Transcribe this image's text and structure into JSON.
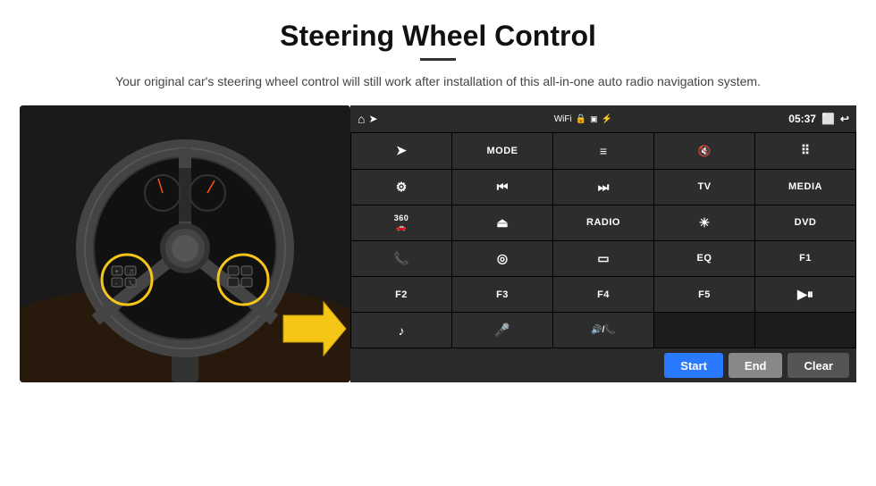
{
  "header": {
    "title": "Steering Wheel Control",
    "subtitle": "Your original car's steering wheel control will still work after installation of this all-in-one auto radio navigation system."
  },
  "status_bar": {
    "time": "05:37",
    "home_icon": "⌂",
    "wifi_icon": "WiFi",
    "lock_icon": "🔒",
    "sd_icon": "SD",
    "bt_icon": "BT",
    "screen_icon": "⬜",
    "back_icon": "↩"
  },
  "buttons": [
    {
      "id": "r1c1",
      "type": "icon",
      "label": "▷",
      "icon": "navigation"
    },
    {
      "id": "r1c2",
      "type": "text",
      "label": "MODE"
    },
    {
      "id": "r1c3",
      "type": "icon",
      "label": "≡",
      "icon": "list"
    },
    {
      "id": "r1c4",
      "type": "icon",
      "label": "🔇",
      "icon": "mute"
    },
    {
      "id": "r1c5",
      "type": "icon",
      "label": "⠿",
      "icon": "apps"
    },
    {
      "id": "r2c1",
      "type": "icon",
      "label": "⚙",
      "icon": "settings"
    },
    {
      "id": "r2c2",
      "type": "icon",
      "label": "⏮",
      "icon": "prev"
    },
    {
      "id": "r2c3",
      "type": "icon",
      "label": "⏭",
      "icon": "next"
    },
    {
      "id": "r2c4",
      "type": "text",
      "label": "TV"
    },
    {
      "id": "r2c5",
      "type": "text",
      "label": "MEDIA"
    },
    {
      "id": "r3c1",
      "type": "icon",
      "label": "360",
      "icon": "360cam"
    },
    {
      "id": "r3c2",
      "type": "icon",
      "label": "▲",
      "icon": "eject"
    },
    {
      "id": "r3c3",
      "type": "text",
      "label": "RADIO"
    },
    {
      "id": "r3c4",
      "type": "icon",
      "label": "☼",
      "icon": "brightness"
    },
    {
      "id": "r3c5",
      "type": "text",
      "label": "DVD"
    },
    {
      "id": "r4c1",
      "type": "icon",
      "label": "📞",
      "icon": "phone"
    },
    {
      "id": "r4c2",
      "type": "icon",
      "label": "◎",
      "icon": "navi"
    },
    {
      "id": "r4c3",
      "type": "icon",
      "label": "▭",
      "icon": "screen"
    },
    {
      "id": "r4c4",
      "type": "text",
      "label": "EQ"
    },
    {
      "id": "r4c5",
      "type": "text",
      "label": "F1"
    },
    {
      "id": "r5c1",
      "type": "text",
      "label": "F2"
    },
    {
      "id": "r5c2",
      "type": "text",
      "label": "F3"
    },
    {
      "id": "r5c3",
      "type": "text",
      "label": "F4"
    },
    {
      "id": "r5c4",
      "type": "text",
      "label": "F5"
    },
    {
      "id": "r5c5",
      "type": "icon",
      "label": "▶⏸",
      "icon": "playpause"
    },
    {
      "id": "r6c1",
      "type": "icon",
      "label": "♪",
      "icon": "music"
    },
    {
      "id": "r6c2",
      "type": "icon",
      "label": "🎤",
      "icon": "mic"
    },
    {
      "id": "r6c3",
      "type": "icon",
      "label": "🔊/📞",
      "icon": "volume-phone"
    },
    {
      "id": "r6c4",
      "type": "empty",
      "label": ""
    },
    {
      "id": "r6c5",
      "type": "empty",
      "label": ""
    }
  ],
  "action_bar": {
    "start_label": "Start",
    "end_label": "End",
    "clear_label": "Clear"
  }
}
